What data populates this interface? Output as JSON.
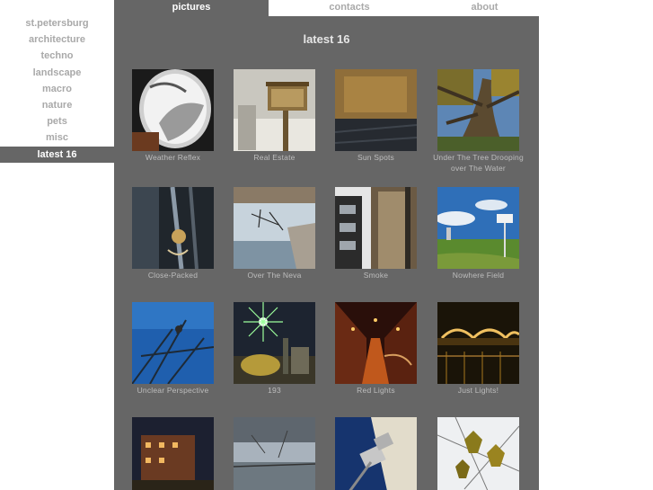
{
  "topnav": {
    "tabs": [
      {
        "label": "pictures",
        "active": true
      },
      {
        "label": "contacts",
        "active": false
      },
      {
        "label": "about",
        "active": false
      }
    ]
  },
  "sidenav": {
    "items": [
      {
        "label": "st.petersburg"
      },
      {
        "label": "architecture"
      },
      {
        "label": "techno"
      },
      {
        "label": "landscape"
      },
      {
        "label": "macro"
      },
      {
        "label": "nature"
      },
      {
        "label": "pets"
      },
      {
        "label": "misc"
      },
      {
        "label": "latest 16",
        "active": true
      }
    ]
  },
  "main": {
    "title": "latest 16",
    "thumbnails": [
      {
        "caption": "Weather Reflex"
      },
      {
        "caption": "Real Estate"
      },
      {
        "caption": "Sun Spots"
      },
      {
        "caption": "Under The Tree Drooping over The Water"
      },
      {
        "caption": "Close-Packed"
      },
      {
        "caption": "Over The Neva"
      },
      {
        "caption": "Smoke"
      },
      {
        "caption": "Nowhere Field"
      },
      {
        "caption": "Unclear Perspective"
      },
      {
        "caption": "193"
      },
      {
        "caption": "Red Lights"
      },
      {
        "caption": "Just Lights!"
      },
      {
        "caption": ""
      },
      {
        "caption": ""
      },
      {
        "caption": ""
      },
      {
        "caption": ""
      }
    ]
  },
  "colors": {
    "panel": "#666666",
    "nav_text": "#a9a9a9",
    "active_text": "#ffffff",
    "caption_text": "#bdbdbd"
  }
}
